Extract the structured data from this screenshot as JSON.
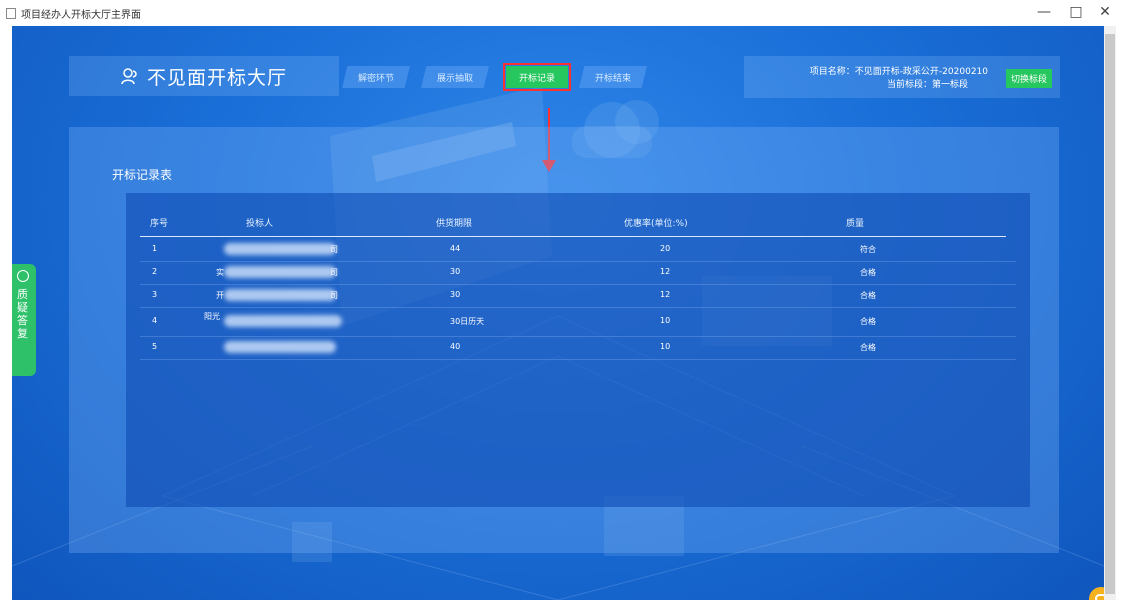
{
  "window": {
    "title": "项目经办人开标大厅主界面",
    "controls": {
      "minimize": "—",
      "maximize": "□",
      "close": "✕"
    }
  },
  "header": {
    "brand": "不见面开标大厅",
    "tabs": [
      {
        "label": "解密环节",
        "active": false
      },
      {
        "label": "展示抽取",
        "active": false
      },
      {
        "label": "开标记录",
        "active": true
      },
      {
        "label": "开标结束",
        "active": false
      }
    ],
    "project": {
      "name_line": "项目名称：不见面开标-政采公开-20200210",
      "section_line": "当前标段：第一标段",
      "switch_label": "切换标段"
    }
  },
  "table": {
    "title": "开标记录表",
    "columns": [
      "序号",
      "投标人",
      "供货期限",
      "优惠率(单位:%)",
      "质量"
    ],
    "rows": [
      {
        "no": "1",
        "bidder_prefix": "",
        "bidder_suffix": "司",
        "period": "44",
        "rate": "20",
        "quality": "符合"
      },
      {
        "no": "2",
        "bidder_prefix": "实",
        "bidder_suffix": "司",
        "period": "30",
        "rate": "12",
        "quality": "合格"
      },
      {
        "no": "3",
        "bidder_prefix": "开",
        "bidder_suffix": "司",
        "period": "30",
        "rate": "12",
        "quality": "合格"
      },
      {
        "no": "4",
        "bidder_prefix": "阳光",
        "bidder_suffix": "",
        "period": "30日历天",
        "rate": "10",
        "quality": "合格"
      },
      {
        "no": "5",
        "bidder_prefix": "",
        "bidder_suffix": "",
        "period": "40",
        "rate": "10",
        "quality": "合格"
      }
    ]
  },
  "side_button": {
    "label": "质疑答复"
  },
  "colors": {
    "accent_green": "#27c760",
    "highlight_red": "#ff3030",
    "chat_orange": "#f6b21e",
    "bg_blue": "#1a6fd8"
  },
  "icons": {
    "brand": "person-group-icon",
    "side": "help-circle-icon",
    "chat": "chat-icon"
  }
}
